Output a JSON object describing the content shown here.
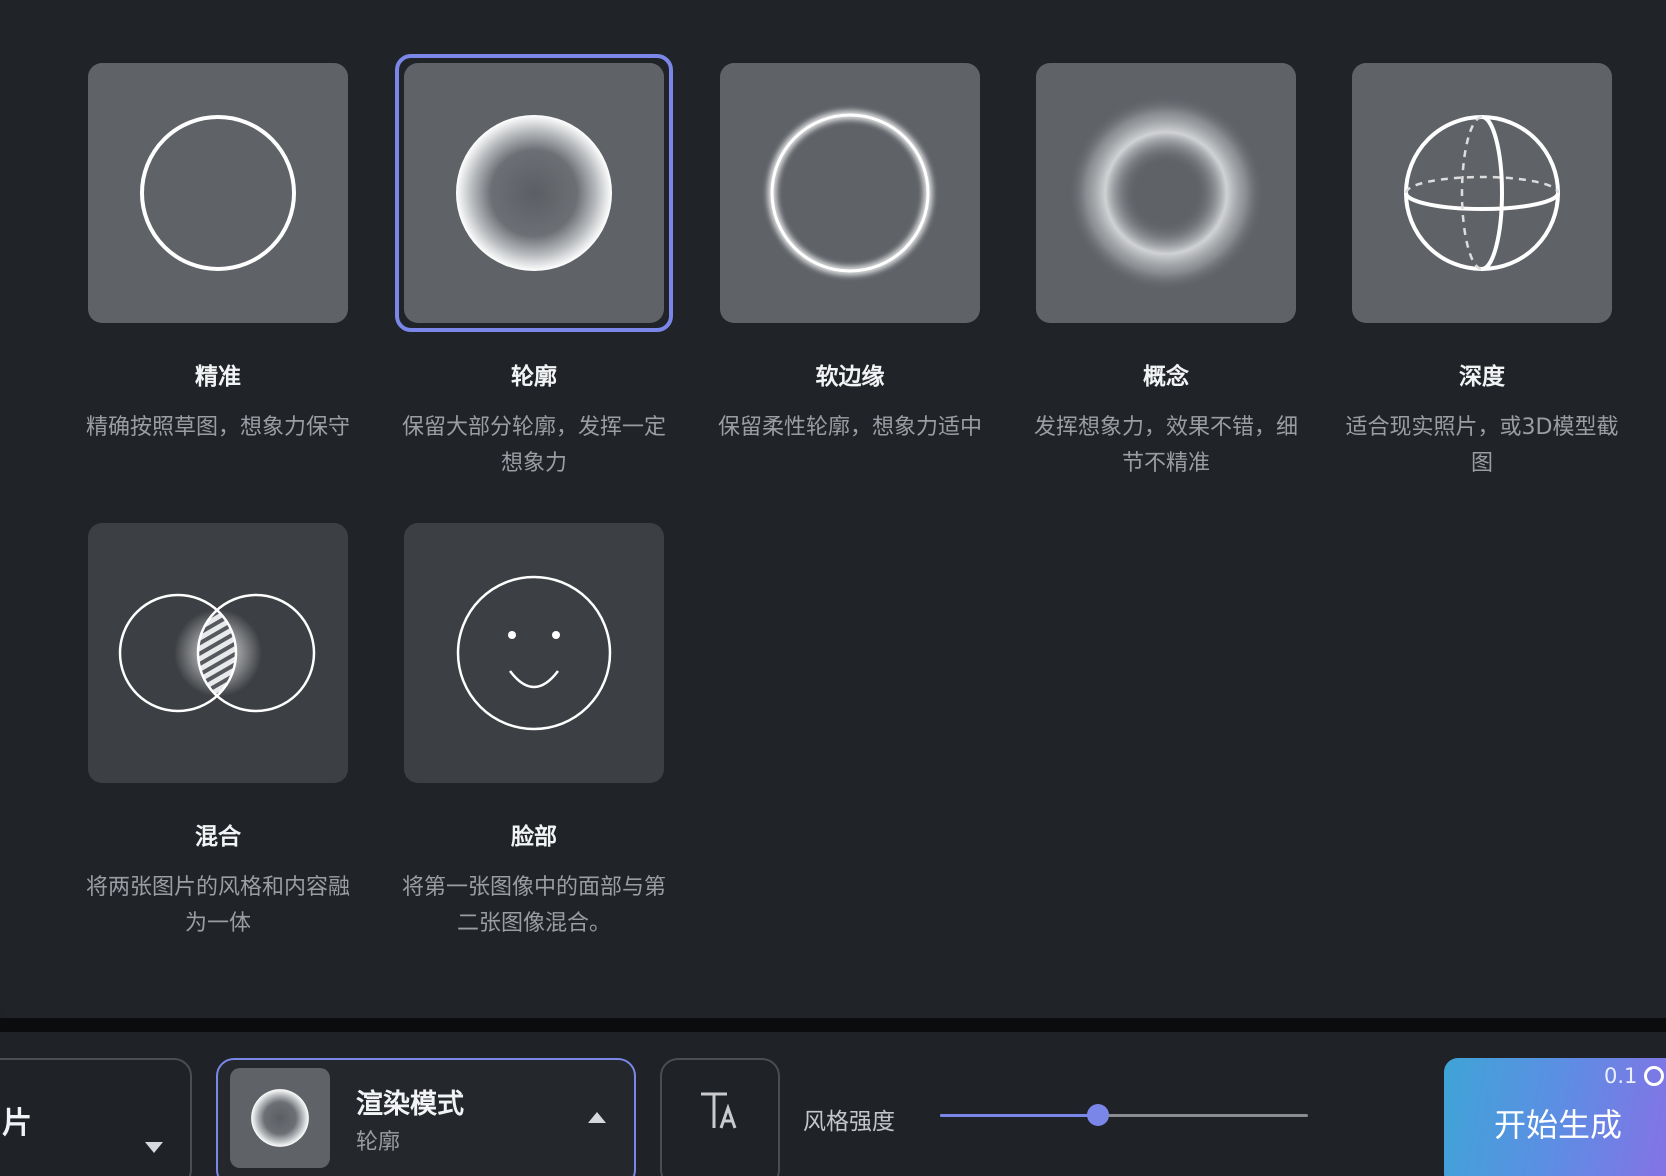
{
  "modes": [
    {
      "id": "precise",
      "title": "精准",
      "desc": "精确按照草图，想象力保守",
      "icon": "thin-circle-icon",
      "selected": false
    },
    {
      "id": "contour",
      "title": "轮廓",
      "desc": "保留大部分轮廓，发挥一定想象力",
      "icon": "glow-sphere-icon",
      "selected": true
    },
    {
      "id": "soft-edge",
      "title": "软边缘",
      "desc": "保留柔性轮廓，想象力适中",
      "icon": "soft-ring-icon",
      "selected": false
    },
    {
      "id": "concept",
      "title": "概念",
      "desc": "发挥想象力，效果不错，细节不精准",
      "icon": "blurred-ring-icon",
      "selected": false
    },
    {
      "id": "depth",
      "title": "深度",
      "desc": "适合现实照片，或3D模型截图",
      "icon": "globe-icon",
      "selected": false
    },
    {
      "id": "blend",
      "title": "混合",
      "desc": "将两张图片的风格和内容融为一体",
      "icon": "venn-icon",
      "selected": false
    },
    {
      "id": "face",
      "title": "脸部",
      "desc": "将第一张图像中的面部与第二张图像混合。",
      "icon": "smiley-icon",
      "selected": false
    }
  ],
  "toolbar": {
    "source_label": "片",
    "render_title": "渲染模式",
    "render_value": "轮廓",
    "style_strength_label": "风格强度",
    "style_strength": 0.43,
    "generate_label": "开始生成",
    "cost": "0.1"
  },
  "colors": {
    "accent": "#7b87e8",
    "card_bg": "#5f6368",
    "card_bg_dark": "#3c3f43",
    "panel_bg": "#202327"
  }
}
